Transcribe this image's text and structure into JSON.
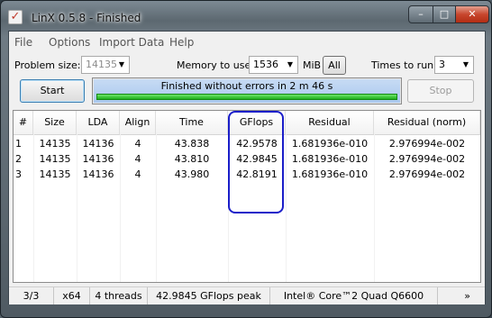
{
  "window": {
    "title": "LinX 0.5.8 - Finished",
    "minimize": "–",
    "maximize": "□",
    "close": "✕"
  },
  "menu": [
    "File",
    "Options",
    "Import Data",
    "Help"
  ],
  "settings": {
    "problem_size_label": "Problem size:",
    "problem_size_value": "14135",
    "memory_label": "Memory to use:",
    "memory_value": "1536",
    "memory_unit": "MiB",
    "all_label": "All",
    "times_label": "Times to run:",
    "times_value": "3"
  },
  "buttons": {
    "start": "Start",
    "stop": "Stop"
  },
  "progress": {
    "text": "Finished without errors in 2 m 46 s",
    "percent": 100
  },
  "table": {
    "columns": [
      "#",
      "Size",
      "LDA",
      "Align",
      "Time",
      "GFlops",
      "Residual",
      "Residual (norm)"
    ],
    "rows": [
      [
        "1",
        "14135",
        "14136",
        "4",
        "43.838",
        "42.9578",
        "1.681936e-010",
        "2.976994e-002"
      ],
      [
        "2",
        "14135",
        "14136",
        "4",
        "43.810",
        "42.9845",
        "1.681936e-010",
        "2.976994e-002"
      ],
      [
        "3",
        "14135",
        "14136",
        "4",
        "43.980",
        "42.8191",
        "1.681936e-010",
        "2.976994e-002"
      ]
    ]
  },
  "status": {
    "runs": "3/3",
    "arch": "x64",
    "threads": "4 threads",
    "peak": "42.9845 GFlops peak",
    "cpu": "Intel® Core™2 Quad Q6600",
    "more": "»"
  },
  "colors": {
    "highlight": "#1b1ec9",
    "progress_green": "#1fae1c",
    "progress_blue": "#a9c8ee"
  }
}
